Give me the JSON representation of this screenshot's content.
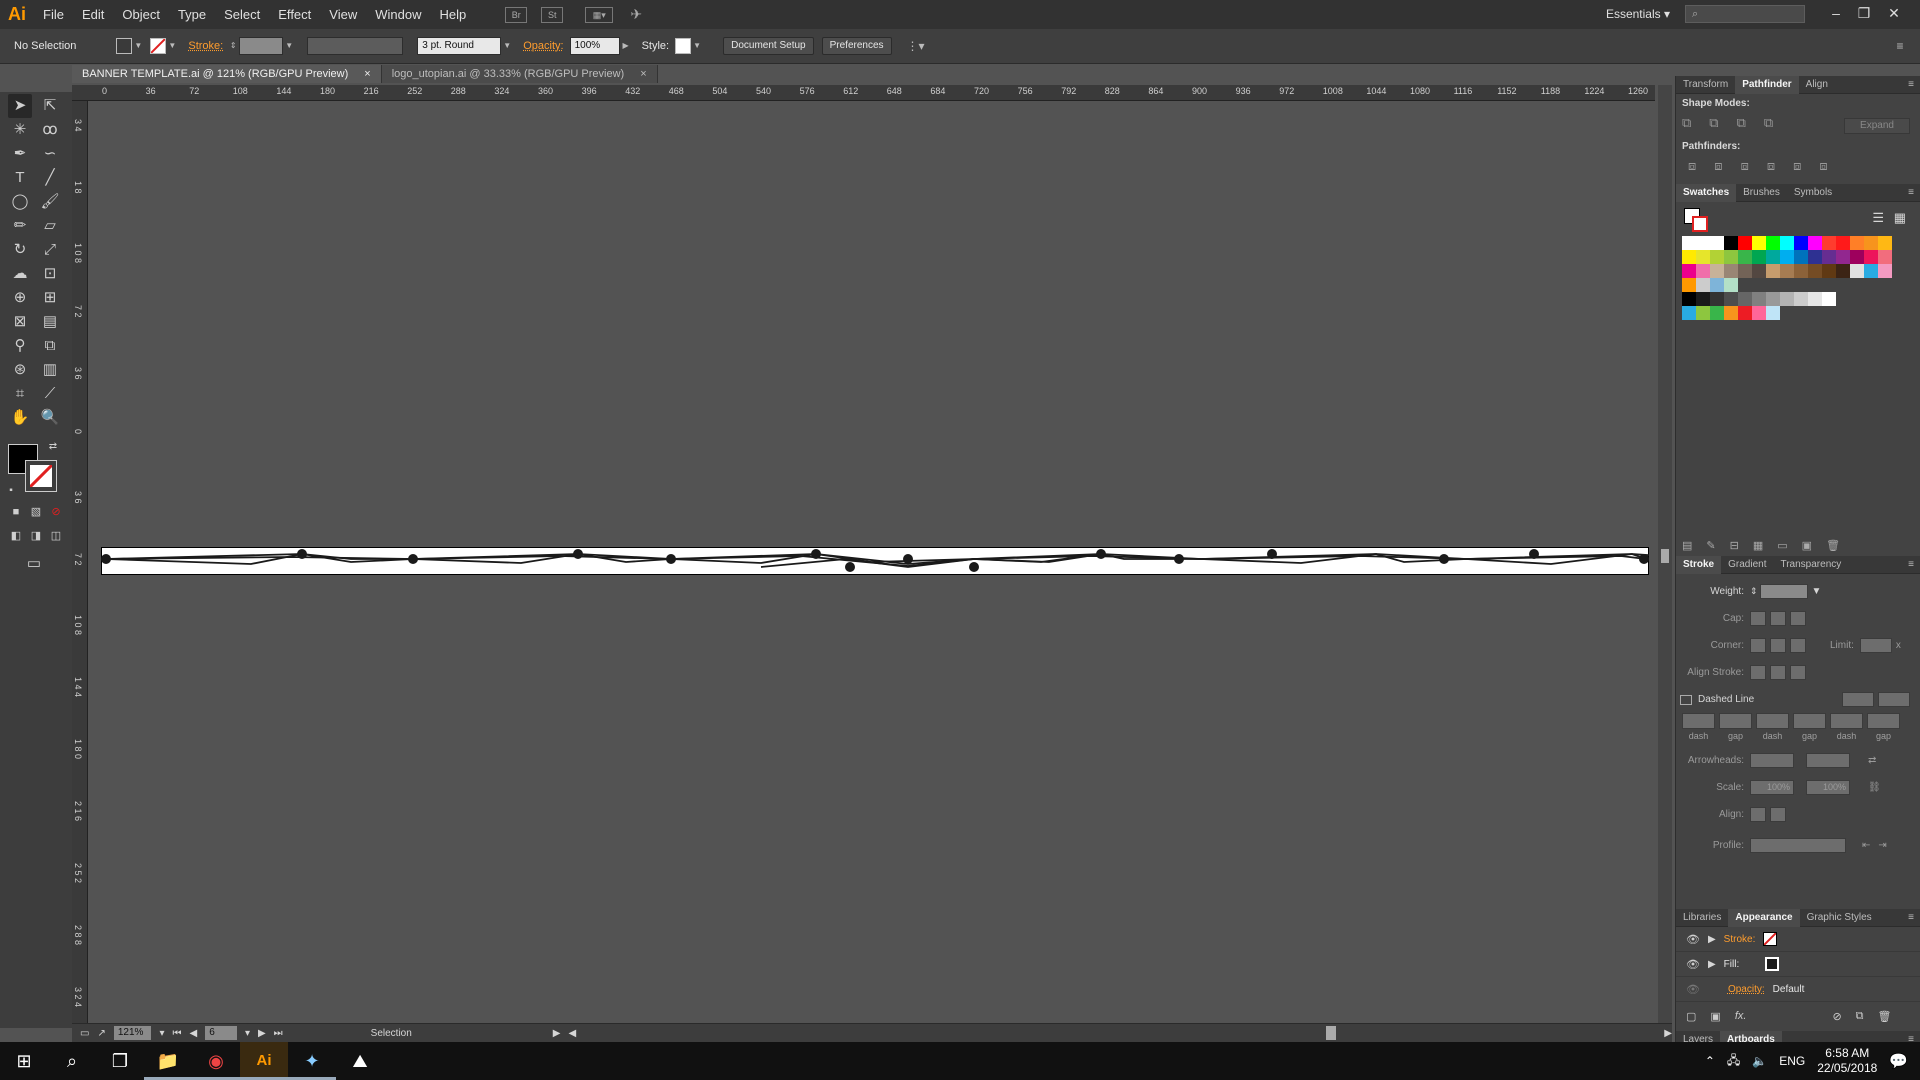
{
  "app": {
    "logo": "Ai",
    "workspace": "Essentials",
    "search_placeholder": ""
  },
  "menu": [
    "File",
    "Edit",
    "Object",
    "Type",
    "Select",
    "Effect",
    "View",
    "Window",
    "Help"
  ],
  "menubar_icons": {
    "br": "Br",
    "st": "St"
  },
  "control": {
    "selection": "No Selection",
    "stroke_label": "Stroke:",
    "brush": "3 pt. Round",
    "opacity_label": "Opacity:",
    "opacity": "100%",
    "style_label": "Style:",
    "doc_setup": "Document Setup",
    "preferences": "Preferences"
  },
  "tabs": [
    {
      "label": "BANNER TEMPLATE.ai @ 121% (RGB/GPU Preview)",
      "close": "×"
    },
    {
      "label": "logo_utopian.ai @ 33.33% (RGB/GPU Preview)",
      "close": "×"
    }
  ],
  "ruler_h": [
    "0",
    "36",
    "72",
    "108",
    "144",
    "180",
    "216",
    "252",
    "288",
    "324",
    "360",
    "396",
    "432",
    "468",
    "504",
    "540",
    "576",
    "612",
    "648",
    "684",
    "720",
    "756",
    "792",
    "828",
    "864",
    "900",
    "936",
    "972",
    "1008",
    "1044",
    "1080",
    "1116",
    "1152",
    "1188",
    "1224",
    "1260"
  ],
  "ruler_v": [
    "3 4",
    "1 8",
    "1 0 8",
    "7 2",
    "3 6",
    "0",
    "3 6",
    "7 2",
    "1 0 8",
    "1 4 4",
    "1 8 0",
    "2 1 6",
    "2 5 2",
    "2 8 8",
    "3 2 4"
  ],
  "status": {
    "zoom": "121%",
    "artboard": "6",
    "mode": "Selection"
  },
  "panels": {
    "top_tabs": [
      "Transform",
      "Pathfinder",
      "Align"
    ],
    "shape_modes": "Shape Modes:",
    "expand": "Expand",
    "pathfinders": "Pathfinders:",
    "swatch_tabs": [
      "Swatches",
      "Brushes",
      "Symbols"
    ],
    "stroke_tabs": [
      "Stroke",
      "Gradient",
      "Transparency"
    ],
    "weight": "Weight:",
    "cap": "Cap:",
    "corner": "Corner:",
    "limit": "Limit:",
    "limit_x": "x",
    "align_stroke": "Align Stroke:",
    "dashed_line": "Dashed Line",
    "dash_labels": [
      "dash",
      "gap",
      "dash",
      "gap",
      "dash",
      "gap"
    ],
    "arrowheads": "Arrowheads:",
    "scale": "Scale:",
    "scale_a": "100%",
    "scale_b": "100%",
    "align": "Align:",
    "profile": "Profile:",
    "appearance_tabs": [
      "Libraries",
      "Appearance",
      "Graphic Styles"
    ],
    "ap_stroke": "Stroke:",
    "ap_fill": "Fill:",
    "ap_opacity": "Opacity:",
    "ap_opacity_val": "Default",
    "fx": "fx.",
    "bottom_tabs": [
      "Layers",
      "Artboards"
    ]
  },
  "swatch_colors": [
    [
      "#ffffff",
      "#ffffff",
      "#ffffff",
      "#000000",
      "#ff0000",
      "#ffff00",
      "#00ff00",
      "#00ffff",
      "#0000ff",
      "#ff00ff",
      "#ff3c2e",
      "#ff1a1a",
      "#ff7f27",
      "#f7941d",
      "#ffb814"
    ],
    [
      "#ffea00",
      "#e6e52b",
      "#b2d235",
      "#8dc63f",
      "#39b54a",
      "#00a651",
      "#00a99d",
      "#00aeef",
      "#0072bc",
      "#2e3192",
      "#662d91",
      "#92278f",
      "#9e005d",
      "#ed145b",
      "#f26d7d"
    ],
    [
      "#ec008c",
      "#f06eaa",
      "#c7b299",
      "#998675",
      "#736357",
      "#534741",
      "#c69c6d",
      "#a67c52",
      "#8c6239",
      "#754c24",
      "#603913",
      "#3c2415",
      "#e0e0e0",
      "#29abe2",
      "#f49ac1"
    ],
    [
      "#ff9900",
      "#cccccc",
      "#7eb4d9",
      "#b3e0c7"
    ],
    [
      "#000000",
      "#1a1a1a",
      "#333333",
      "#4d4d4d",
      "#666666",
      "#808080",
      "#999999",
      "#b3b3b3",
      "#cccccc",
      "#e6e6e6",
      "#ffffff"
    ],
    [
      "#29abe2",
      "#8dc63f",
      "#39b54a",
      "#f7941d",
      "#ed1c24",
      "#ff6699",
      "#bfe4f7"
    ]
  ],
  "taskbar": {
    "time": "6:58 AM",
    "date": "22/05/2018",
    "lang": "ENG",
    "apps": [
      "start",
      "search",
      "task-view",
      "file-explorer",
      "chrome",
      "illustrator",
      "app-5",
      "photos"
    ]
  }
}
